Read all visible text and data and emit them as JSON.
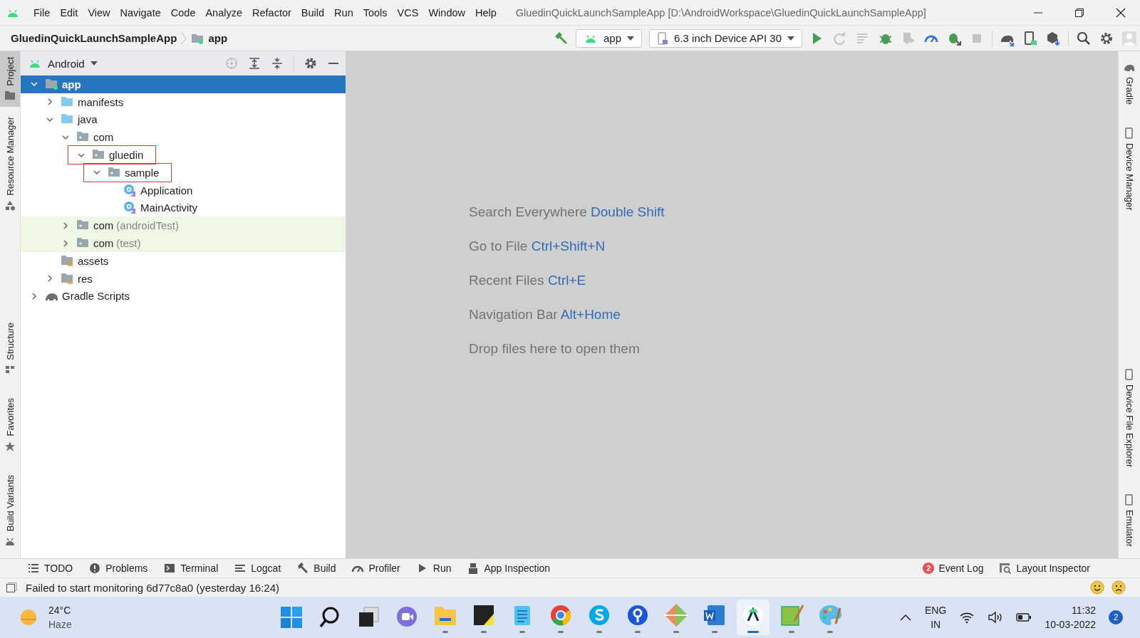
{
  "menu_bar": {
    "items": [
      "File",
      "Edit",
      "View",
      "Navigate",
      "Code",
      "Analyze",
      "Refactor",
      "Build",
      "Run",
      "Tools",
      "VCS",
      "Window",
      "Help"
    ],
    "title": "GluedinQuickLaunchSampleApp [D:\\AndroidWorkspace\\GluedinQuickLaunchSampleApp]"
  },
  "breadcrumb": {
    "project": "GluedinQuickLaunchSampleApp",
    "module": "app"
  },
  "toolbar": {
    "run_configuration": "app",
    "device": "6.3 inch Device API 30",
    "buttons": [
      {
        "kind": "run",
        "disabled": false
      },
      {
        "kind": "rerun",
        "disabled": true
      },
      {
        "kind": "apply",
        "disabled": true
      },
      {
        "kind": "debug",
        "disabled": false
      },
      {
        "kind": "coverage",
        "disabled": true
      },
      {
        "kind": "profile",
        "disabled": false
      },
      {
        "kind": "attach",
        "disabled": false
      },
      {
        "kind": "stop",
        "disabled": true
      },
      {
        "kind": "sync",
        "disabled": false
      },
      {
        "kind": "device",
        "disabled": false
      },
      {
        "kind": "sdk",
        "disabled": false
      },
      {
        "kind": "search",
        "disabled": false
      },
      {
        "kind": "settings",
        "disabled": false
      },
      {
        "kind": "account",
        "disabled": false
      }
    ]
  },
  "left_strip": {
    "top": [
      {
        "label": "Project",
        "kind": "folder",
        "selected": true
      },
      {
        "label": "Resource Manager",
        "kind": "shapes",
        "selected": false
      }
    ],
    "bottom": [
      {
        "label": "Structure",
        "kind": "blocks",
        "selected": false
      },
      {
        "label": "Favorites",
        "kind": "star",
        "selected": false
      },
      {
        "label": "Build Variants",
        "kind": "android",
        "selected": false
      }
    ]
  },
  "right_strip": {
    "top": [
      {
        "label": "Gradle",
        "kind": "elephant"
      },
      {
        "label": "Device Manager",
        "kind": "phone"
      }
    ],
    "bottom": [
      {
        "label": "Device File Explorer",
        "kind": "phone"
      },
      {
        "label": "Emulator",
        "kind": "phone"
      }
    ]
  },
  "project_panel": {
    "view": "Android",
    "tree": [
      {
        "label": "app",
        "kind": "module",
        "expanded": true,
        "selected": true,
        "highlighted": false,
        "children": [
          {
            "label": "manifests",
            "kind": "source",
            "expanded": false,
            "selected": false,
            "highlighted": false
          },
          {
            "label": "java",
            "kind": "source",
            "expanded": true,
            "selected": false,
            "highlighted": false,
            "children": [
              {
                "label": "com",
                "kind": "package",
                "expanded": true,
                "selected": false,
                "highlighted": false,
                "children": [
                  {
                    "label": "gluedin",
                    "kind": "package",
                    "expanded": true,
                    "selected": false,
                    "highlighted": true,
                    "children": [
                      {
                        "label": "sample",
                        "kind": "package",
                        "expanded": true,
                        "selected": false,
                        "highlighted": true,
                        "children": [
                          {
                            "label": "Application",
                            "kind": "class",
                            "selected": false,
                            "highlighted": false
                          },
                          {
                            "label": "MainActivity",
                            "kind": "class",
                            "selected": false,
                            "highlighted": false
                          }
                        ]
                      }
                    ]
                  }
                ]
              },
              {
                "label": "com",
                "suffix": "(androidTest)",
                "kind": "package",
                "expanded": false,
                "selected": false,
                "highlighted": false,
                "test": true
              },
              {
                "label": "com",
                "suffix": "(test)",
                "kind": "package",
                "expanded": false,
                "selected": false,
                "highlighted": false,
                "test": true
              }
            ]
          },
          {
            "label": "assets",
            "kind": "resource",
            "selected": false,
            "highlighted": false
          },
          {
            "label": "res",
            "kind": "resource",
            "expanded": false,
            "selected": false,
            "highlighted": false
          }
        ]
      },
      {
        "label": "Gradle Scripts",
        "kind": "gradle",
        "expanded": false,
        "selected": false,
        "highlighted": false
      }
    ]
  },
  "editor": {
    "hints": [
      {
        "text": "Search Everywhere",
        "shortcut": "Double Shift"
      },
      {
        "text": "Go to File",
        "shortcut": "Ctrl+Shift+N"
      },
      {
        "text": "Recent Files",
        "shortcut": "Ctrl+E"
      },
      {
        "text": "Navigation Bar",
        "shortcut": "Alt+Home"
      },
      {
        "text": "Drop files here to open them"
      }
    ]
  },
  "tool_windows": {
    "left": [
      {
        "label": "TODO",
        "kind": "list"
      },
      {
        "label": "Problems",
        "kind": "problems"
      },
      {
        "label": "Terminal",
        "kind": "terminal"
      },
      {
        "label": "Logcat",
        "kind": "logcat"
      },
      {
        "label": "Build",
        "kind": "build"
      },
      {
        "label": "Profiler",
        "kind": "profiler"
      },
      {
        "label": "Run",
        "kind": "run"
      },
      {
        "label": "App Inspection",
        "kind": "inspection"
      }
    ],
    "right": [
      {
        "label": "Event Log",
        "kind": "eventlog",
        "badge": "2"
      },
      {
        "label": "Layout Inspector",
        "kind": "layout"
      }
    ]
  },
  "status_bar": {
    "message": "Failed to start monitoring 6d77c8a0 (yesterday 16:24)"
  },
  "taskbar": {
    "weather": {
      "temperature": "24°C",
      "condition": "Haze"
    },
    "apps": [
      {
        "kind": "start",
        "selected": false,
        "running": false
      },
      {
        "kind": "search",
        "selected": false,
        "running": false
      },
      {
        "kind": "taskview",
        "selected": false,
        "running": false
      },
      {
        "kind": "chat",
        "selected": false,
        "running": false
      },
      {
        "kind": "explorer",
        "selected": false,
        "running": true
      },
      {
        "kind": "notes",
        "selected": false,
        "running": true
      },
      {
        "kind": "notepad",
        "selected": false,
        "running": true
      },
      {
        "kind": "browser",
        "selected": false,
        "running": true
      },
      {
        "kind": "skype",
        "selected": false,
        "running": true
      },
      {
        "kind": "pin",
        "selected": false,
        "running": true
      },
      {
        "kind": "git",
        "selected": false,
        "running": true
      },
      {
        "kind": "word",
        "selected": false,
        "running": true
      },
      {
        "kind": "studio",
        "selected": true,
        "running": true
      },
      {
        "kind": "editor",
        "selected": false,
        "running": true
      },
      {
        "kind": "paint",
        "selected": false,
        "running": true
      }
    ],
    "language": "ENG",
    "region": "IN",
    "time": "11:32",
    "date": "10-03-2022",
    "notifications": "2"
  }
}
